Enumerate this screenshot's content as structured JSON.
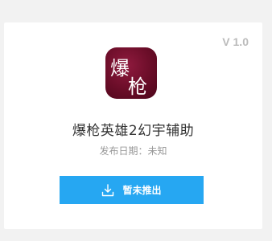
{
  "card": {
    "version": "V 1.0",
    "app_name": "爆枪英雄2幻宇辅助",
    "release_label": "发布日期：",
    "release_value": "未知",
    "download_button_label": "暂未推出",
    "download_icon": "download-icon",
    "app_icon_text": [
      "爆",
      "枪"
    ]
  },
  "colors": {
    "background": "#f2f2f2",
    "card": "#ffffff",
    "button": "#26a7f2",
    "icon_bg": "#6a0d28"
  }
}
